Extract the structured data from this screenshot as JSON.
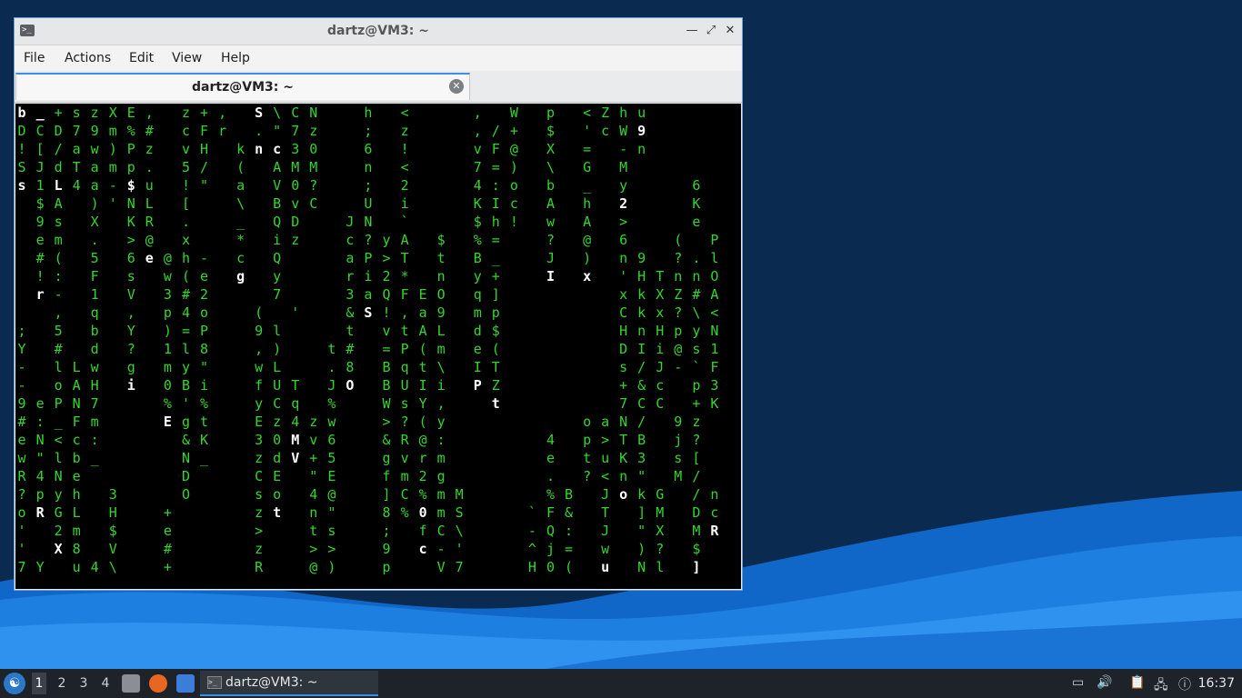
{
  "window": {
    "title": "dartz@VM3: ~"
  },
  "menu": [
    "File",
    "Actions",
    "Edit",
    "View",
    "Help"
  ],
  "tab": {
    "label": "dartz@VM3: ~"
  },
  "terminal": {
    "colors": {
      "green": "#33d62b",
      "white": "#ffffff",
      "background": "#000000"
    },
    "rows": [
      "b _ + s z X E ,   z + ,   S \\ C N     h   <       ,   W   p   < Z h u",
      "D C D 7 9 m % #   c F r   . \" 7 z     ;   z       , / +   $   ' c W 9",
      "! [ / a w ) P z   v H   k n c 3 0     6   !       v F @   X   =   - n",
      "S J d T a m p .   5 /   (   A M M     n   <       7 = )   \\   G   M",
      "s 1 L 4 a - $ u   ! \"   a   V 0 ?     ;   2       4 : o   b   _   y       6",
      "  $ A   ) ' N L   [     \\   B v C     U   i       K I c   A   h   2       K",
      "  9 s   X   K R   .     _   Q D     J N   `       $ h !   w   A   >       e",
      "  e m   .   > @   x     *   i z     c ? y A   $   % =     ?   @   6     (   P",
      "  # (   5   6 e @ h -   c   Q       a P > T   t   B _     J   )   n 9   ? . l",
      "  ! :   F   s   w ( e   g   y       r i 2 *   n   y +     I   x   ' H T n n O",
      "  r -   1   V   3 # 2       7       3 a Q F E O   q ]             x k X Z # A",
      "    ,   q   ,   p 4 o     (   '     & S ! , a 9   m p             C k x ? \\ <",
      ";   5   b   Y   ) = P     9 l       t   v t A L   d $             H n H p y N",
      "Y   #   d   ?   1 l 8     , )     t #   = P ( m   e (             D I i @ s 1",
      "-   l L w   g   m y \"     w L     . 8   B q t \\   I T             s / J - ` F",
      "-   o A H   i   0 B i     f U T   J O   B U I i   P Z             + & c   p 3",
      "9 e P N 7       % ' %     y C q   %     W s Y ,     t             7 C C   + K",
      "# : _ F m       E g t     E z 4 z w     > ? ( y               o a N /   9 z",
      "e N < c :         & K     3 0 M v 6     & R @ :           4   p > T B   j ?",
      "w \" l b _         N _     z d V + 5     g v r m           e   t u K 3   s [",
      "R 4 N e           D       C E   \" E     f m 2 g           .   ? < n \"   M /",
      "? p y h   3       O       s o   4 @     ] C % m M         % B   J o k G   / n",
      "o R G L   H     +         z t   n \"     8 % 0 m S       ` F &   T   ] M   D c",
      "'   2 m   $     e         >     t s     ;   f C \\       - Q :   J   \" X   M R",
      "'   X 8   V     #         z     > >     9   c - '       ^ j =   w   ) ?   $",
      "7 Y   u 4 \\     +         R     @ )     p     V 7       H 0 (   u   N l   ]"
    ],
    "white_cells": [
      [
        0,
        0
      ],
      [
        0,
        1
      ],
      [
        0,
        13
      ],
      [
        0,
        30
      ],
      [
        1,
        34
      ],
      [
        2,
        13
      ],
      [
        2,
        14
      ],
      [
        2,
        35
      ],
      [
        4,
        0
      ],
      [
        4,
        2
      ],
      [
        4,
        6
      ],
      [
        5,
        17
      ],
      [
        5,
        33
      ],
      [
        6,
        28
      ],
      [
        7,
        16
      ],
      [
        8,
        7
      ],
      [
        9,
        12
      ],
      [
        9,
        29
      ],
      [
        9,
        31
      ],
      [
        10,
        1
      ],
      [
        11,
        19
      ],
      [
        15,
        6
      ],
      [
        15,
        18
      ],
      [
        15,
        25
      ],
      [
        16,
        26
      ],
      [
        17,
        8
      ],
      [
        18,
        15
      ],
      [
        19,
        5
      ],
      [
        19,
        11
      ],
      [
        19,
        15
      ],
      [
        21,
        10
      ],
      [
        21,
        33
      ],
      [
        22,
        1
      ],
      [
        22,
        14
      ],
      [
        22,
        22
      ],
      [
        23,
        38
      ],
      [
        24,
        2
      ],
      [
        24,
        22
      ],
      [
        25,
        32
      ],
      [
        25,
        37
      ]
    ]
  },
  "taskbar": {
    "workspaces": [
      "1",
      "2",
      "3",
      "4"
    ],
    "task_label": "dartz@VM3: ~",
    "clock": "16:37",
    "start_icon": "lubuntu-logo",
    "tray_icons": [
      "battery-icon",
      "volume-icon",
      "clipboard-icon",
      "network-icon",
      "notification-icon"
    ]
  }
}
